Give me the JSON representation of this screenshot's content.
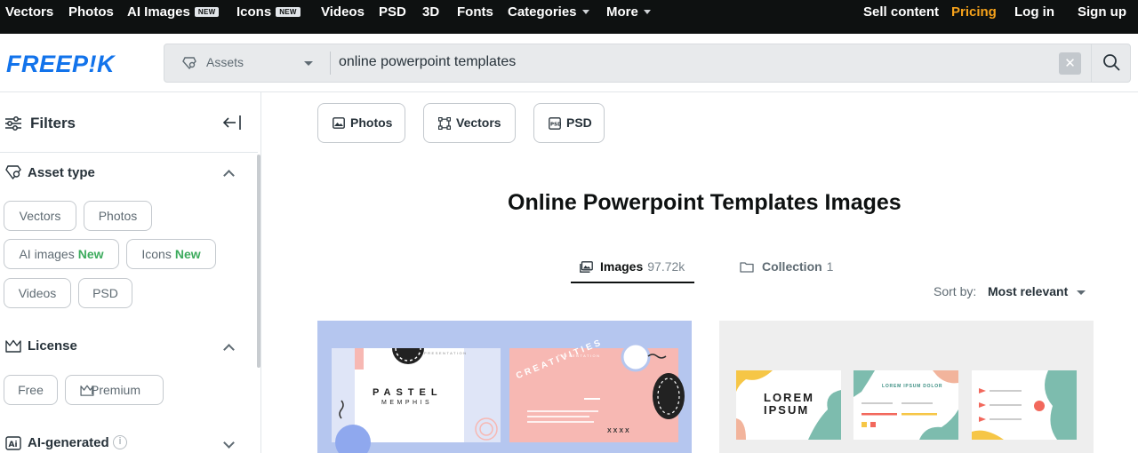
{
  "topnav": {
    "items": [
      {
        "label": "Vectors"
      },
      {
        "label": "Photos"
      },
      {
        "label": "AI Images",
        "badge": "NEW"
      },
      {
        "label": "Icons",
        "badge": "NEW"
      },
      {
        "label": "Videos"
      },
      {
        "label": "PSD"
      },
      {
        "label": "3D"
      },
      {
        "label": "Fonts"
      },
      {
        "label": "Categories"
      },
      {
        "label": "More"
      }
    ],
    "sell": "Sell content",
    "pricing": "Pricing",
    "login": "Log in",
    "signup": "Sign up",
    "pricing_color": "#f6a21b"
  },
  "header": {
    "logo": "FREEP!K",
    "logo_color": "#1273eb",
    "search": {
      "scope": "Assets",
      "query": "online powerpoint templates",
      "clear_icon": "close-icon",
      "search_icon": "search-icon"
    }
  },
  "sidebar": {
    "title": "Filters",
    "asset_type": {
      "title": "Asset type",
      "chips": [
        {
          "label": "Vectors"
        },
        {
          "label": "Photos"
        },
        {
          "label": "AI images",
          "new": "New"
        },
        {
          "label": "Icons",
          "new": "New"
        },
        {
          "label": "Videos"
        },
        {
          "label": "PSD"
        }
      ]
    },
    "license": {
      "title": "License",
      "chips": [
        {
          "label": "Free"
        },
        {
          "label": "Premium"
        }
      ]
    },
    "ai_generated": {
      "title": "AI-generated",
      "info": "i"
    },
    "new_color": "#3dab5d"
  },
  "main": {
    "type_buttons": [
      {
        "label": "Photos"
      },
      {
        "label": "Vectors"
      },
      {
        "label": "PSD"
      }
    ],
    "page_title": "Online Powerpoint Templates Images",
    "tabs": [
      {
        "label": "Images",
        "count": "97.72k",
        "active": true
      },
      {
        "label": "Collection",
        "count": "1",
        "active": false
      }
    ],
    "sort": {
      "label": "Sort by:",
      "value": "Most relevant"
    },
    "cards": [
      {
        "slides": [
          {
            "title": "PASTEL",
            "subtitle": "MEMPHIS",
            "header": "PRESENTATION"
          },
          {
            "title": "CREATIVITIES",
            "header": "PRESENTATION",
            "mark": "XXXX"
          }
        ]
      },
      {
        "slides": [
          {
            "title": "LOREM",
            "subtitle": "IPSUM"
          },
          {
            "title": "LOREM IPSUM DOLOR"
          },
          {
            "title": ""
          }
        ]
      }
    ]
  }
}
